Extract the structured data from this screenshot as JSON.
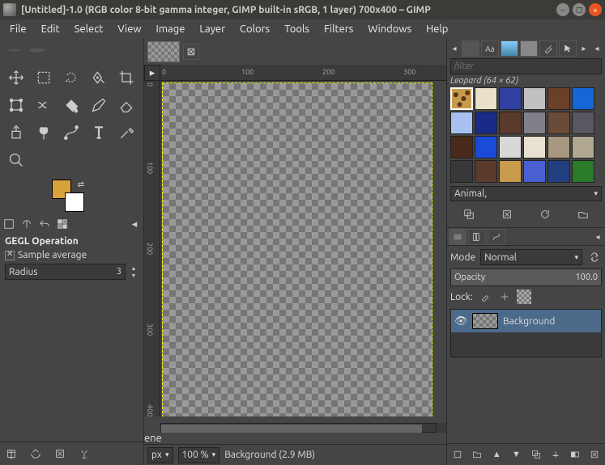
{
  "titlebar": {
    "title": "[Untitled]-1.0 (RGB color 8-bit gamma integer, GIMP built-in sRGB, 1 layer) 700x400 – GIMP"
  },
  "menubar": {
    "items": [
      "File",
      "Edit",
      "Select",
      "View",
      "Image",
      "Layer",
      "Colors",
      "Tools",
      "Filters",
      "Windows",
      "Help"
    ]
  },
  "toolbox": {
    "tools": [
      "move-tool",
      "rect-select-tool",
      "free-select-tool",
      "fuzzy-select-tool",
      "crop-tool",
      "rotate-tool",
      "scale-tool",
      "warp-tool",
      "paintbrush-tool",
      "eraser-tool",
      "clone-tool",
      "smudge-tool",
      "paths-tool",
      "text-tool",
      "color-picker-tool",
      "zoom-tool"
    ],
    "fg_color": "#d8a23c",
    "bg_color": "#ffffff"
  },
  "tool_options": {
    "heading": "GEGL Operation",
    "sample_average_label": "Sample average",
    "radius_label": "Radius",
    "radius_value": "3"
  },
  "canvas": {
    "ruler_h_ticks": [
      "0",
      "100",
      "200",
      "300"
    ],
    "ruler_v_ticks": [
      "0",
      "100",
      "200",
      "300",
      "400"
    ]
  },
  "statusbar": {
    "unit": "px",
    "zoom": "100 %",
    "status": "Background (2.9 MB)"
  },
  "patterns": {
    "filter_placeholder": "filter",
    "selected_label": "Leopard (64 × 62)",
    "tag": "Animal,",
    "swatches": [
      "#c89a4c",
      "#e8e0c8",
      "#3040a0",
      "#c0c0c0",
      "#6a4028",
      "#1566d6",
      "#a8c0f0",
      "#1a2a88",
      "#5a3a2a",
      "#808088",
      "#6a4a38",
      "#585860",
      "#4a2a1a",
      "#1a4ad8",
      "#d8d8d8",
      "#e8e0d0",
      "#a89880",
      "#b0a890",
      "#383838",
      "#5a3a2a",
      "#c89a4c",
      "#4860d0",
      "#204080",
      "#2a7a2a"
    ]
  },
  "layers": {
    "mode_label": "Mode",
    "mode_value": "Normal",
    "opacity_label": "Opacity",
    "opacity_value": "100.0",
    "lock_label": "Lock:",
    "items": [
      {
        "name": "Background",
        "visible": true
      }
    ]
  }
}
